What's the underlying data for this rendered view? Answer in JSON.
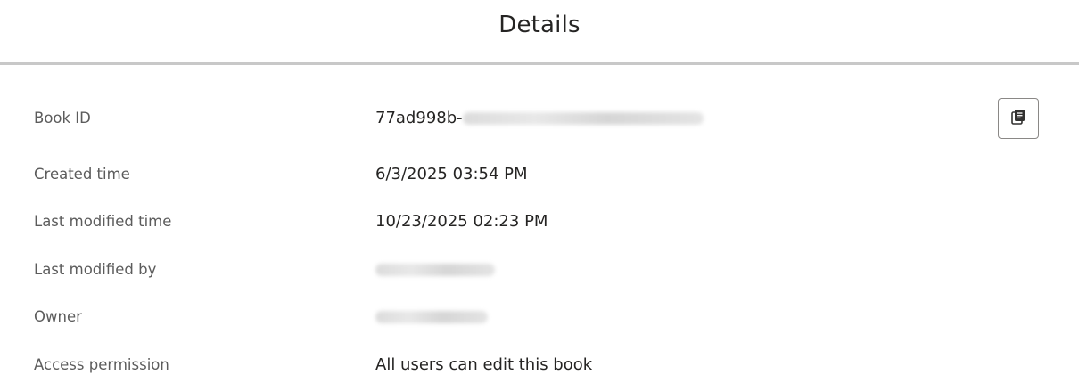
{
  "header": {
    "title": "Details"
  },
  "details": {
    "book_id": {
      "label": "Book ID",
      "value_visible": "77ad998b-"
    },
    "created_time": {
      "label": "Created time",
      "value": "6/3/2025 03:54 PM"
    },
    "last_modified_time": {
      "label": "Last modified time",
      "value": "10/23/2025 02:23 PM"
    },
    "last_modified_by": {
      "label": "Last modified by"
    },
    "owner": {
      "label": "Owner"
    },
    "access_permission": {
      "label": "Access permission",
      "value": "All users can edit this book"
    }
  },
  "copy_button": {
    "icon": "copy-icon"
  },
  "colors": {
    "text": "#252423",
    "label": "#5c5c5c",
    "divider": "#c8c8c8",
    "button_border": "#8a8886"
  }
}
